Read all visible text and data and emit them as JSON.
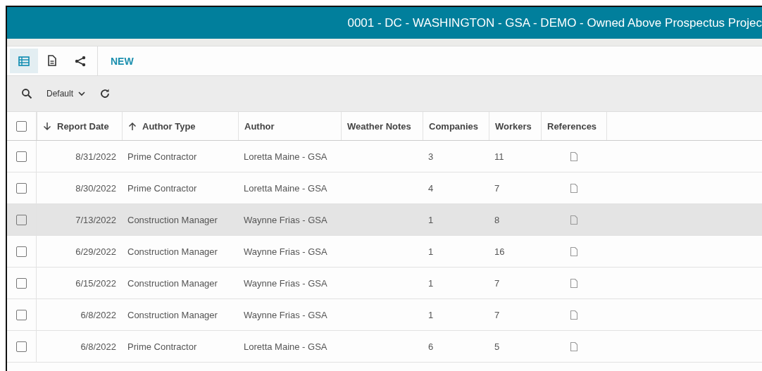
{
  "header": {
    "title": "0001 - DC - WASHINGTON - GSA - DEMO - Owned Above Prospectus Projec"
  },
  "toolbar": {
    "views": [
      {
        "kind": "list",
        "selected": true
      },
      {
        "kind": "document",
        "selected": false
      },
      {
        "kind": "share",
        "selected": false
      }
    ],
    "new_button": "NEW"
  },
  "filter_bar": {
    "view_select": "Default"
  },
  "table": {
    "select_all": {
      "checked": false
    },
    "columns": [
      {
        "label": "Report Date",
        "sort": {
          "descending": true
        }
      },
      {
        "label": "Author Type",
        "sort": {
          "descending": false
        }
      },
      {
        "label": "Author"
      },
      {
        "label": "Weather Notes"
      },
      {
        "label": "Companies"
      },
      {
        "label": "Workers"
      },
      {
        "label": "References"
      }
    ],
    "rows": [
      {
        "checked": false,
        "highlighted": false,
        "report_date": "8/31/2022",
        "author_type": "Prime Contractor",
        "author": "Loretta Maine - GSA",
        "companies": "3",
        "workers": "11"
      },
      {
        "checked": false,
        "highlighted": false,
        "report_date": "8/30/2022",
        "author_type": "Prime Contractor",
        "author": "Loretta Maine - GSA",
        "companies": "4",
        "workers": "7"
      },
      {
        "checked": false,
        "highlighted": true,
        "report_date": "7/13/2022",
        "author_type": "Construction Manager",
        "author": "Waynne Frias - GSA",
        "companies": "1",
        "workers": "8"
      },
      {
        "checked": false,
        "highlighted": false,
        "report_date": "6/29/2022",
        "author_type": "Construction Manager",
        "author": "Waynne Frias - GSA",
        "companies": "1",
        "workers": "16"
      },
      {
        "checked": false,
        "highlighted": false,
        "report_date": "6/15/2022",
        "author_type": "Construction Manager",
        "author": "Waynne Frias - GSA",
        "companies": "1",
        "workers": "7"
      },
      {
        "checked": false,
        "highlighted": false,
        "report_date": "6/8/2022",
        "author_type": "Construction Manager",
        "author": "Waynne Frias - GSA",
        "companies": "1",
        "workers": "7"
      },
      {
        "checked": false,
        "highlighted": false,
        "report_date": "6/8/2022",
        "author_type": "Prime Contractor",
        "author": "Loretta Maine - GSA",
        "companies": "6",
        "workers": "5"
      }
    ]
  }
}
